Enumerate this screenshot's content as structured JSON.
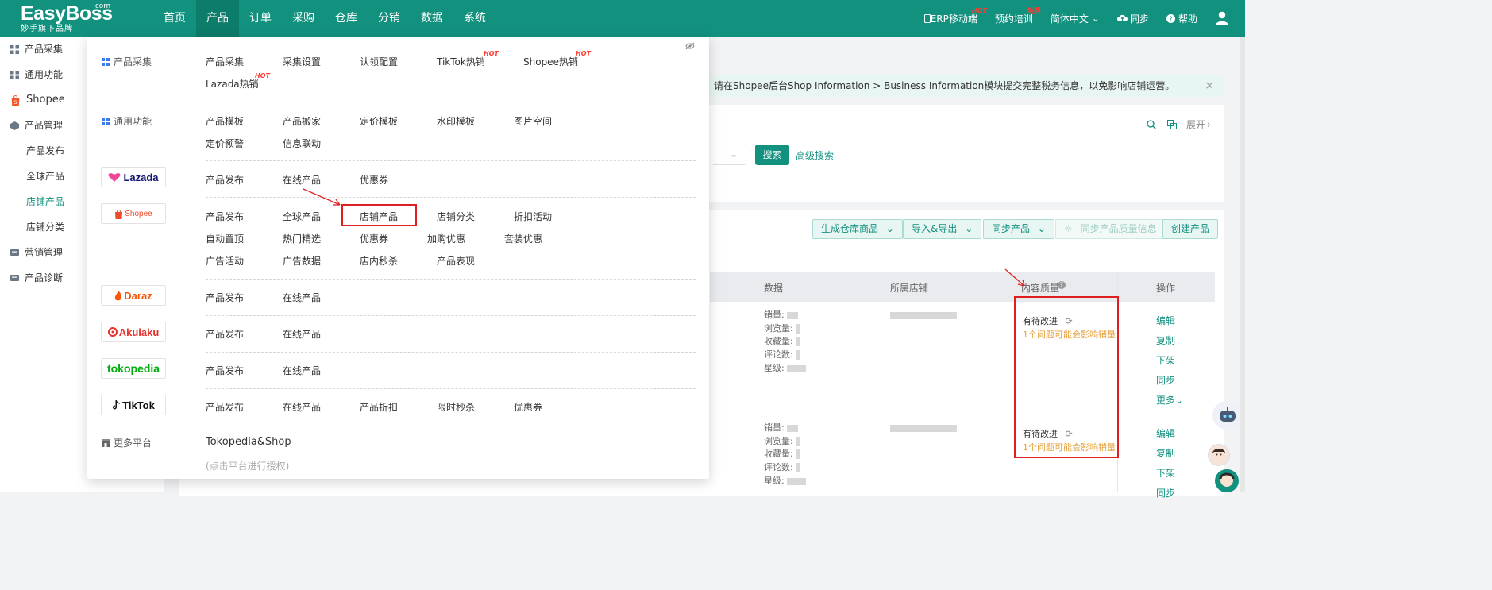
{
  "brand": {
    "name": "EasyBoss",
    "com": ".com",
    "slogan": "妙手旗下品牌"
  },
  "nav": {
    "items": [
      "首页",
      "产品",
      "订单",
      "采购",
      "仓库",
      "分销",
      "数据",
      "系统"
    ],
    "active": "产品"
  },
  "top_right": {
    "erp_mobile": "ERP移动端",
    "erp_hot": "HOT",
    "training": "预约培训",
    "training_badge": "免费",
    "language": "简体中文",
    "sync": "同步",
    "help": "帮助"
  },
  "sidebar": {
    "items": [
      {
        "label": "产品采集"
      },
      {
        "label": "通用功能"
      },
      {
        "label": "Shopee"
      },
      {
        "label": "产品管理"
      },
      {
        "label": "产品发布"
      },
      {
        "label": "全球产品"
      },
      {
        "label": "店铺产品"
      },
      {
        "label": "店铺分类"
      },
      {
        "label": "营销管理"
      },
      {
        "label": "产品诊断"
      }
    ]
  },
  "notice": {
    "text": "准。请在Shopee后台Shop Information > Business Information模块提交完整税务信息，以免影响店铺运营。"
  },
  "search": {
    "button": "搜索",
    "advanced": "高级搜索",
    "expand": "展开"
  },
  "toolbar": {
    "generate": "生成仓库商品",
    "import_export": "导入&导出",
    "sync_products": "同步产品",
    "sync_quality": "同步产品质量信息",
    "create": "创建产品"
  },
  "table": {
    "headers": {
      "data": "数据",
      "shop": "所属店铺",
      "quality": "内容质量",
      "ops": "操作"
    },
    "stat_labels": [
      "销量:",
      "浏览量:",
      "收藏量:",
      "评论数:",
      "星级:"
    ],
    "rows": [
      {
        "quality_status": "有待改进",
        "quality_issue": "1个问题可能会影响销量",
        "ops": [
          "编辑",
          "复制",
          "下架",
          "同步",
          "更多"
        ]
      },
      {
        "quality_status": "有待改进",
        "quality_issue": "1个问题可能会影响销量",
        "ops": [
          "编辑",
          "复制",
          "下架",
          "同步"
        ]
      }
    ]
  },
  "dropdown": {
    "cat_collect": "产品采集",
    "collect_links": [
      "产品采集",
      "采集设置",
      "认领配置",
      "TikTok热销",
      "Shopee热销",
      "Lazada热销"
    ],
    "hot": "HOT",
    "cat_common": "通用功能",
    "common_links": [
      "产品模板",
      "产品搬家",
      "定价模板",
      "水印模板",
      "图片空间",
      "定价预警",
      "信息联动"
    ],
    "lazada_logo": "Lazada",
    "lazada_links": [
      "产品发布",
      "在线产品",
      "优惠券"
    ],
    "shopee_logo": "Shopee",
    "shopee_links": [
      "产品发布",
      "全球产品",
      "店铺产品",
      "店铺分类",
      "折扣活动",
      "自动置顶",
      "热门精选",
      "优惠券",
      "加购优惠",
      "套装优惠",
      "广告活动",
      "广告数据",
      "店内秒杀",
      "产品表现"
    ],
    "daraz_logo": "Daraz",
    "daraz_links": [
      "产品发布",
      "在线产品"
    ],
    "akulaku_logo": "Akulaku",
    "akulaku_links": [
      "产品发布",
      "在线产品"
    ],
    "tokopedia_logo": "tokopedia",
    "tokopedia_links": [
      "产品发布",
      "在线产品"
    ],
    "tiktok_logo": "TikTok",
    "tiktok_links": [
      "产品发布",
      "在线产品",
      "产品折扣",
      "限时秒杀",
      "优惠券"
    ],
    "cat_more": "更多平台",
    "more_link": "Tokopedia&Shop",
    "more_hint": "(点击平台进行授权)"
  },
  "colors": {
    "primary": "#13917f",
    "warn": "#e6a23c",
    "annotation": "#e02020"
  }
}
